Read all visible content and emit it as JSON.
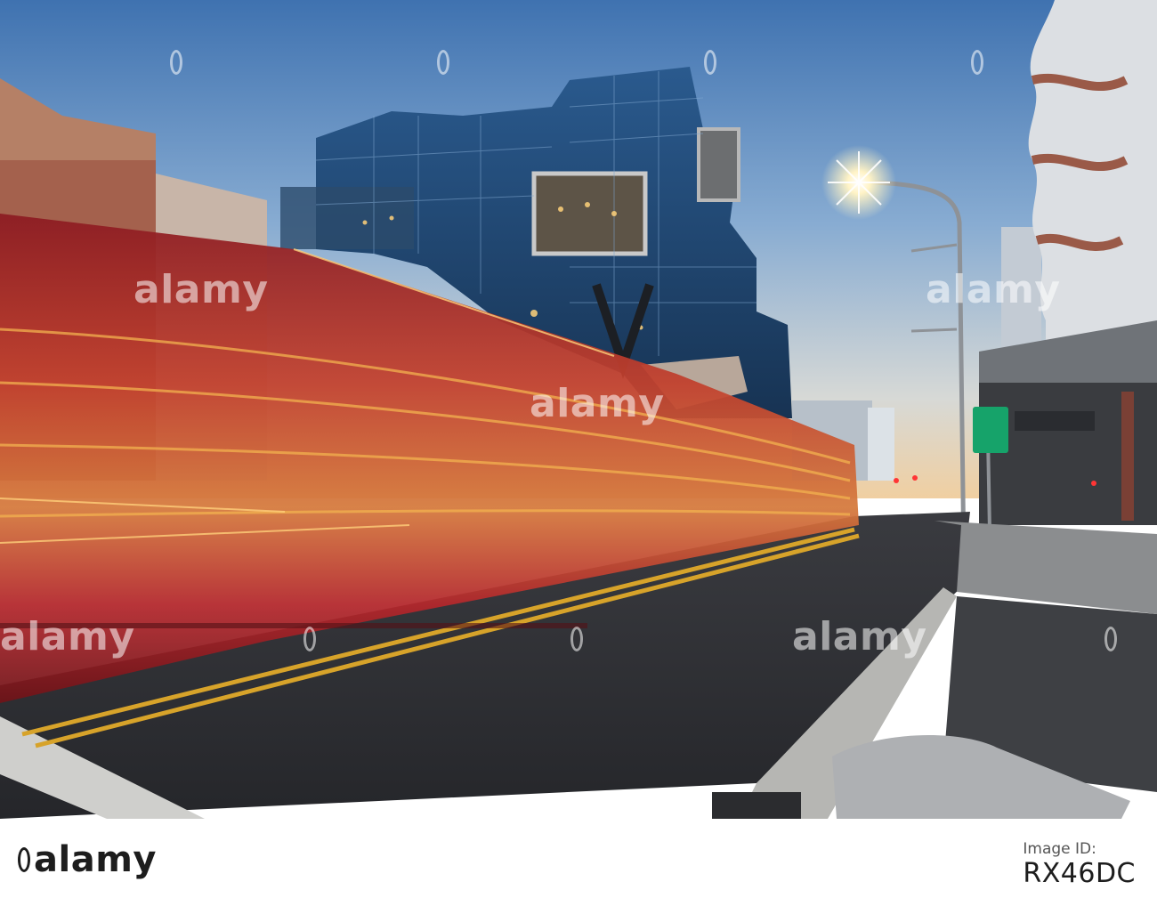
{
  "watermark": {
    "text": "alamy"
  },
  "footer": {
    "brand": "alamy",
    "image_id_label": "Image ID:",
    "image_id": "RX46DC"
  },
  "palette": {
    "sky_top": "#4f7fb8",
    "sky_bottom": "#e9d6b8",
    "tram_red": "#b5222b",
    "light_streak": "#f0a040",
    "road": "#2d2f34",
    "lane_yellow": "#d7a32a",
    "glass_blue": "#1e4a7a"
  }
}
